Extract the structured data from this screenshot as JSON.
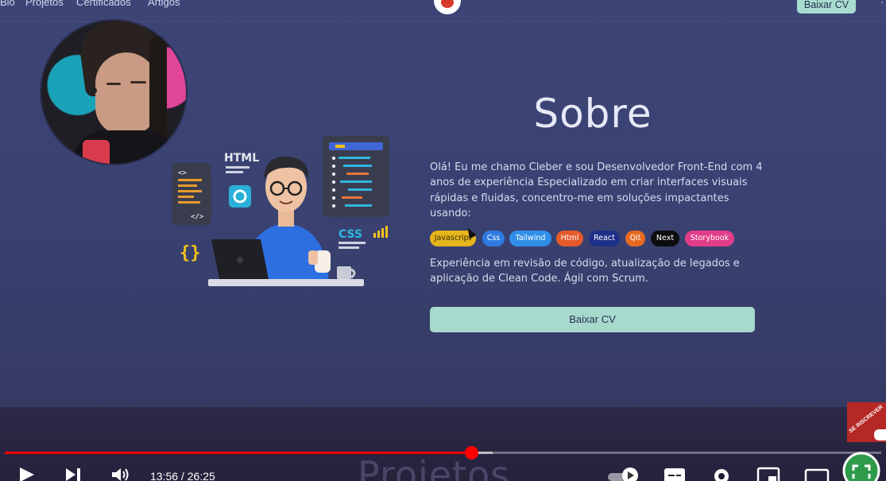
{
  "nav": {
    "links": [
      "Bio",
      "Projetos",
      "Certificados",
      "Artigos"
    ],
    "cv_button": "Baixar CV",
    "menu_glyph": "⋮"
  },
  "about": {
    "title": "Sobre",
    "paragraph1": "Olá! Eu me chamo Cleber e sou Desenvolvedor Front-End com 4 anos de experiência Especializado em criar interfaces visuais rápidas e fluidas, concentro-me em soluções impactantes usando:",
    "tags": [
      {
        "label": "Javascript",
        "color": "#e5b51c",
        "text": "#3a2c08"
      },
      {
        "label": "Css",
        "color": "#2f7ae0",
        "text": "#ffffff"
      },
      {
        "label": "Tailwind",
        "color": "#2f8fe8",
        "text": "#ffffff"
      },
      {
        "label": "Html",
        "color": "#e65a2a",
        "text": "#ffffff"
      },
      {
        "label": "React",
        "color": "#1e2f8a",
        "text": "#ffffff"
      },
      {
        "label": "Qit",
        "color": "#e86a22",
        "text": "#ffffff"
      },
      {
        "label": "Next",
        "color": "#0d0d10",
        "text": "#ffffff"
      },
      {
        "label": "Storybook",
        "color": "#e23d8a",
        "text": "#ffffff"
      }
    ],
    "paragraph2": "Experiência em revisão de código, atualização de legados e aplicação de Clean Code. Ágil com Scrum.",
    "cv_button": "Baixar CV"
  },
  "illustration": {
    "html_label": "HTML",
    "css_label": "CSS",
    "code_glyph": "<>",
    "close_glyph": "</>",
    "braces_glyph": "{}"
  },
  "next_section": {
    "title": "Projetos"
  },
  "subscribe": {
    "label": "SE INSCREVER"
  },
  "player": {
    "current_time": "13:56",
    "duration": "26:25",
    "time_display": "13:56 / 26:25",
    "progress": 0.532,
    "buffered": 0.557,
    "accent": "#ff0000"
  },
  "colors": {
    "site_bg": "#3b4374",
    "cv_button": "#a7d9cc"
  }
}
